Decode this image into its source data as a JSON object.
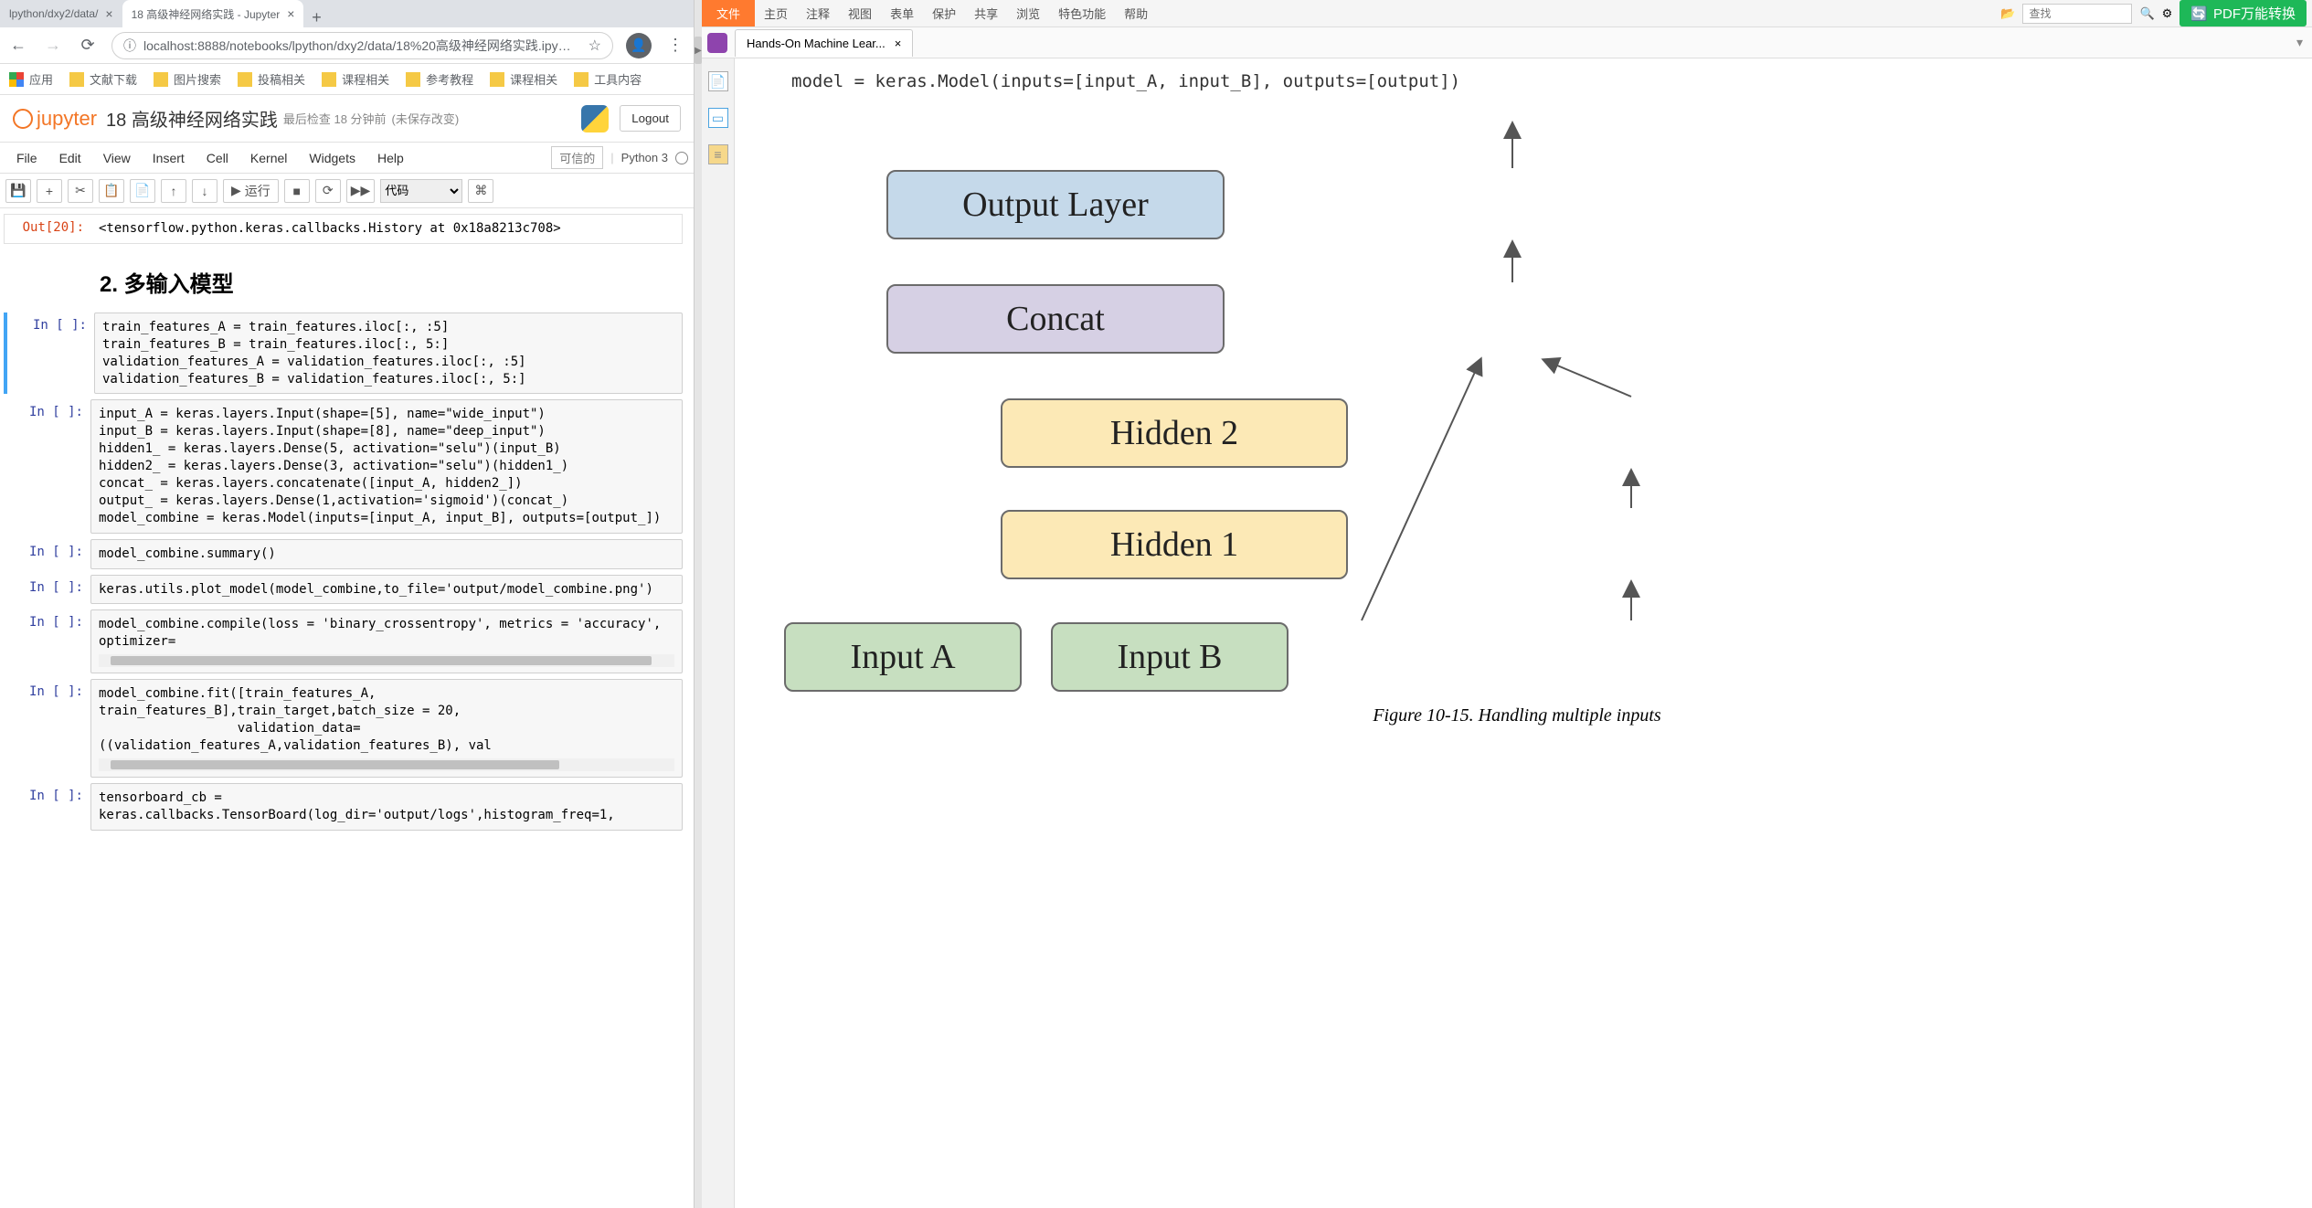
{
  "chrome": {
    "tabs": [
      {
        "title": "lpython/dxy2/data/",
        "active": false
      },
      {
        "title": "18 高级神经网络实践 - Jupyter",
        "active": true
      }
    ],
    "url": "localhost:8888/notebooks/lpython/dxy2/data/18%20高级神经网络实践.ipy…"
  },
  "bookmarks": [
    "应用",
    "文献下载",
    "图片搜索",
    "投稿相关",
    "课程相关",
    "参考教程",
    "课程相关",
    "工具内容"
  ],
  "jupyter": {
    "brand": "jupyter",
    "title": "18 高级神经网络实践",
    "checkpoint": "最后检查 18 分钟前",
    "save_state": "(未保存改变)",
    "logout": "Logout",
    "menu": [
      "File",
      "Edit",
      "View",
      "Insert",
      "Cell",
      "Kernel",
      "Widgets",
      "Help"
    ],
    "trusted": "可信的",
    "kernel": "Python 3",
    "run_label": "运行",
    "celltype": "代码"
  },
  "notebook": {
    "out_prompt": "Out[20]:",
    "out_text": "<tensorflow.python.keras.callbacks.History at 0x18a8213c708>",
    "heading": "2. 多输入模型",
    "cells": [
      {
        "prompt": "In [ ]:",
        "code": "train_features_A = train_features.iloc[:, :5]\ntrain_features_B = train_features.iloc[:, 5:]\nvalidation_features_A = validation_features.iloc[:, :5]\nvalidation_features_B = validation_features.iloc[:, 5:]"
      },
      {
        "prompt": "In [ ]:",
        "code": "input_A = keras.layers.Input(shape=[5], name=\"wide_input\")\ninput_B = keras.layers.Input(shape=[8], name=\"deep_input\")\nhidden1_ = keras.layers.Dense(5, activation=\"selu\")(input_B)\nhidden2_ = keras.layers.Dense(3, activation=\"selu\")(hidden1_)\nconcat_ = keras.layers.concatenate([input_A, hidden2_])\noutput_ = keras.layers.Dense(1,activation='sigmoid')(concat_)\nmodel_combine = keras.Model(inputs=[input_A, input_B], outputs=[output_])"
      },
      {
        "prompt": "In [ ]:",
        "code": "model_combine.summary()"
      },
      {
        "prompt": "In [ ]:",
        "code": "keras.utils.plot_model(model_combine,to_file='output/model_combine.png')"
      },
      {
        "prompt": "In [ ]:",
        "code": "model_combine.compile(loss = 'binary_crossentropy', metrics = 'accuracy', optimizer="
      },
      {
        "prompt": "In [ ]:",
        "code": "model_combine.fit([train_features_A, train_features_B],train_target,batch_size = 20,\n                  validation_data=((validation_features_A,validation_features_B), val"
      },
      {
        "prompt": "In [ ]:",
        "code": "tensorboard_cb = keras.callbacks.TensorBoard(log_dir='output/logs',histogram_freq=1,"
      }
    ]
  },
  "pdf": {
    "menu": [
      "主页",
      "注释",
      "视图",
      "表单",
      "保护",
      "共享",
      "浏览",
      "特色功能",
      "帮助"
    ],
    "file_label": "文件",
    "search_placeholder": "查找",
    "convert_label": "PDF万能转换",
    "tab_title": "Hands-On Machine Lear...",
    "code_line": "model = keras.Model(inputs=[input_A, input_B], outputs=[output])",
    "diagram": {
      "output": "Output Layer",
      "concat": "Concat",
      "h2": "Hidden 2",
      "h1": "Hidden 1",
      "ia": "Input A",
      "ib": "Input B"
    },
    "caption": "Figure 10-15. Handling multiple inputs"
  }
}
